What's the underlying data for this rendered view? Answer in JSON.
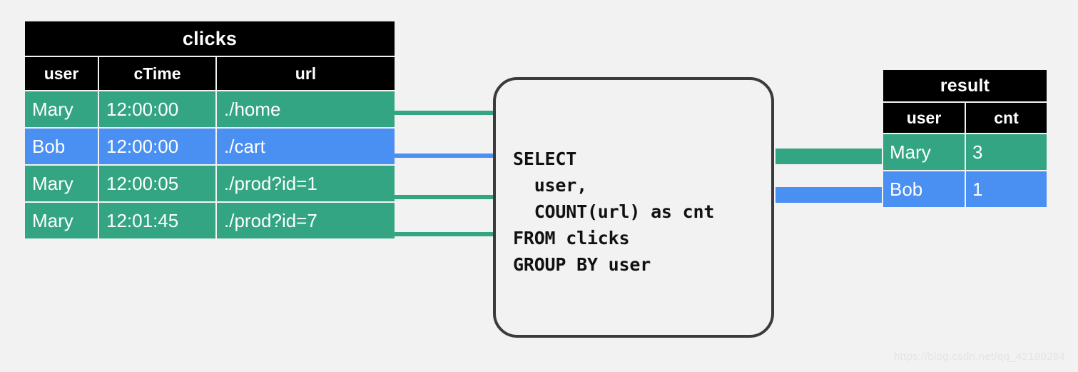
{
  "background_color": "#f2f2f2",
  "palette": {
    "green": "#33a583",
    "blue": "#4a8ff2",
    "header_bg": "#000000",
    "header_fg": "#ffffff",
    "box_border": "#3b3b3b"
  },
  "source_table": {
    "name": "clicks",
    "columns": [
      "user",
      "cTime",
      "url"
    ],
    "rows": [
      {
        "user": "Mary",
        "cTime": "12:00:00",
        "url": "./home",
        "color": "green"
      },
      {
        "user": "Bob",
        "cTime": "12:00:00",
        "url": "./cart",
        "color": "blue"
      },
      {
        "user": "Mary",
        "cTime": "12:00:05",
        "url": "./prod?id=1",
        "color": "green"
      },
      {
        "user": "Mary",
        "cTime": "12:01:45",
        "url": "./prod?id=7",
        "color": "green"
      }
    ]
  },
  "query": {
    "sql": "SELECT\n  user,\n  COUNT(url) as cnt\nFROM clicks\nGROUP BY user"
  },
  "result_table": {
    "name": "result",
    "columns": [
      "user",
      "cnt"
    ],
    "rows": [
      {
        "user": "Mary",
        "cnt": "3",
        "color": "green"
      },
      {
        "user": "Bob",
        "cnt": "1",
        "color": "blue"
      }
    ]
  },
  "connectors": {
    "input_lines": [
      {
        "color": "green",
        "row": "Mary / ./home"
      },
      {
        "color": "blue",
        "row": "Bob / ./cart"
      },
      {
        "color": "green",
        "row": "Mary / ./prod?id=1"
      },
      {
        "color": "green",
        "row": "Mary / ./prod?id=7"
      }
    ],
    "output_arrows": [
      {
        "color": "green",
        "row": "Mary / 3"
      },
      {
        "color": "blue",
        "row": "Bob / 1"
      }
    ]
  },
  "watermark": "https://blog.csdn.net/qq_42180284"
}
